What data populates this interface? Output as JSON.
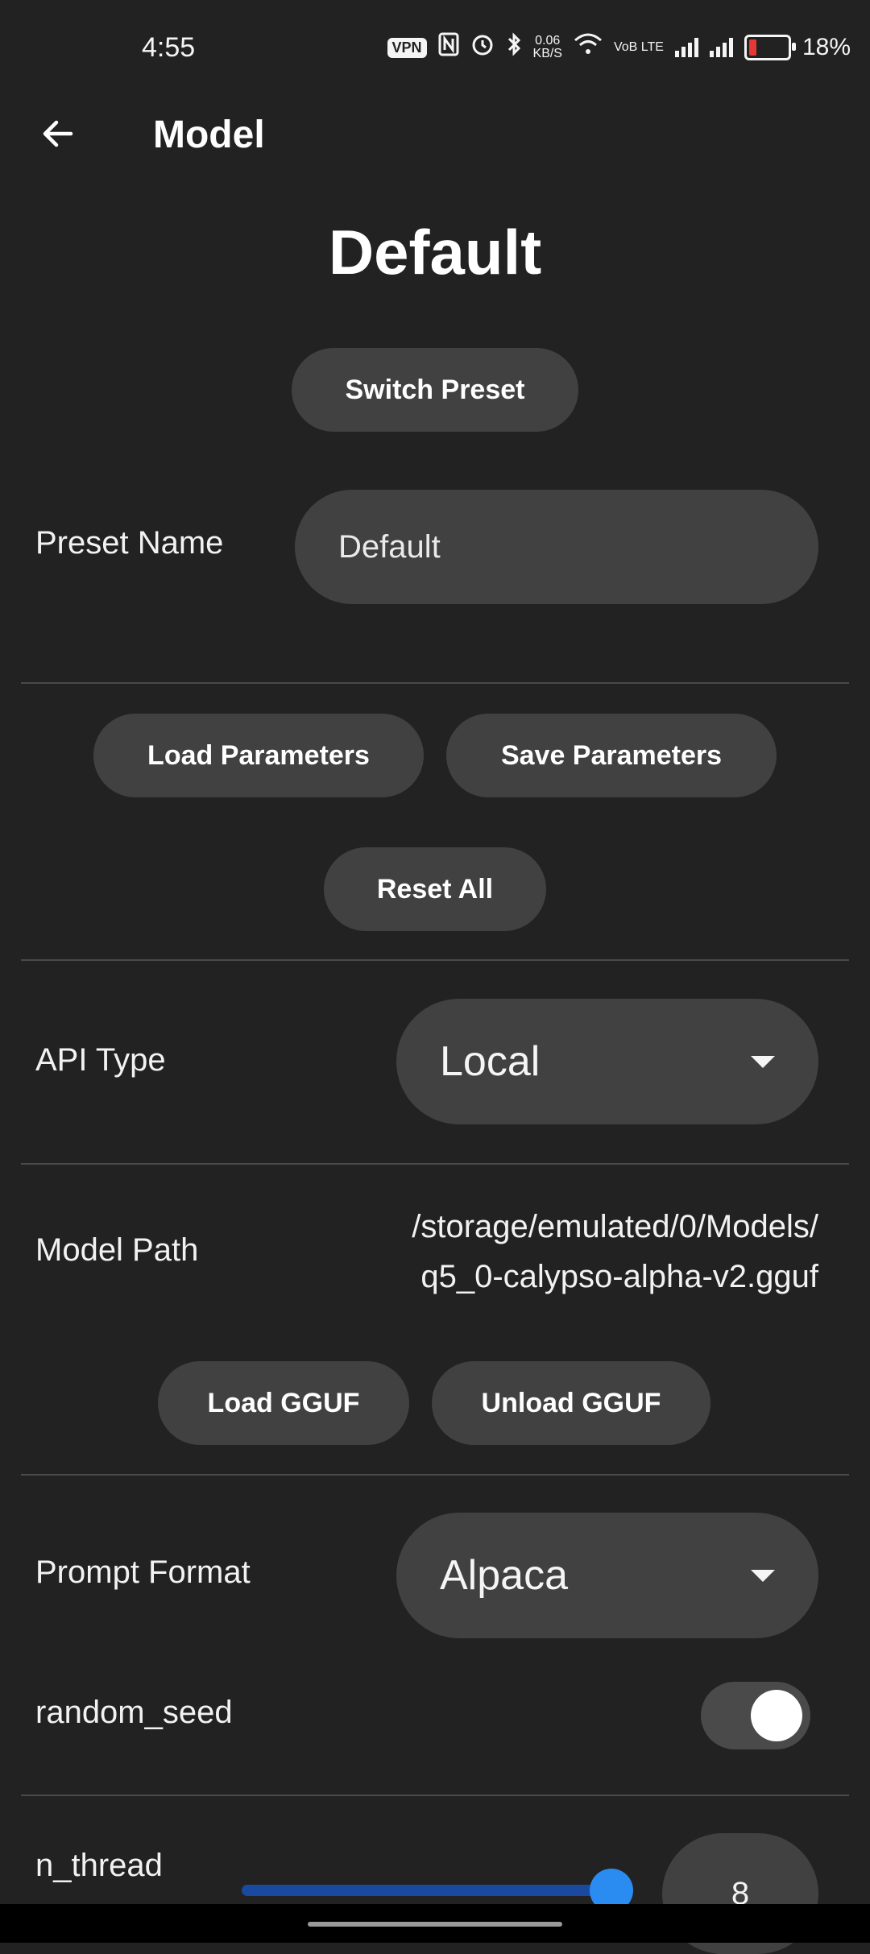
{
  "status_bar": {
    "time": "4:55",
    "vpn_badge": "VPN",
    "speed_value": "0.06",
    "speed_unit": "KB/S",
    "network_badge": "VoB LTE",
    "battery_percent": "18%",
    "battery_level": 0.18
  },
  "app_bar": {
    "title": "Model",
    "back_icon": "arrow-left-icon"
  },
  "preset": {
    "title": "Default",
    "switch_label": "Switch Preset",
    "name_label": "Preset Name",
    "name_value": "Default"
  },
  "params": {
    "load_label": "Load Parameters",
    "save_label": "Save Parameters",
    "reset_label": "Reset All"
  },
  "api": {
    "label": "API Type",
    "value": "Local"
  },
  "model": {
    "path_label": "Model Path",
    "path_line1": "/storage/emulated/0/Models/",
    "path_line2": "q5_0-calypso-alpha-v2.gguf",
    "load_label": "Load GGUF",
    "unload_label": "Unload GGUF"
  },
  "prompt": {
    "label": "Prompt Format",
    "value": "Alpaca"
  },
  "random_seed": {
    "label": "random_seed",
    "enabled": true
  },
  "n_thread": {
    "label": "n_thread",
    "value": "8"
  },
  "colors": {
    "background": "#222222",
    "surface": "#414141",
    "slider_active": "#2a8cf0",
    "battery_low": "#e53935"
  }
}
